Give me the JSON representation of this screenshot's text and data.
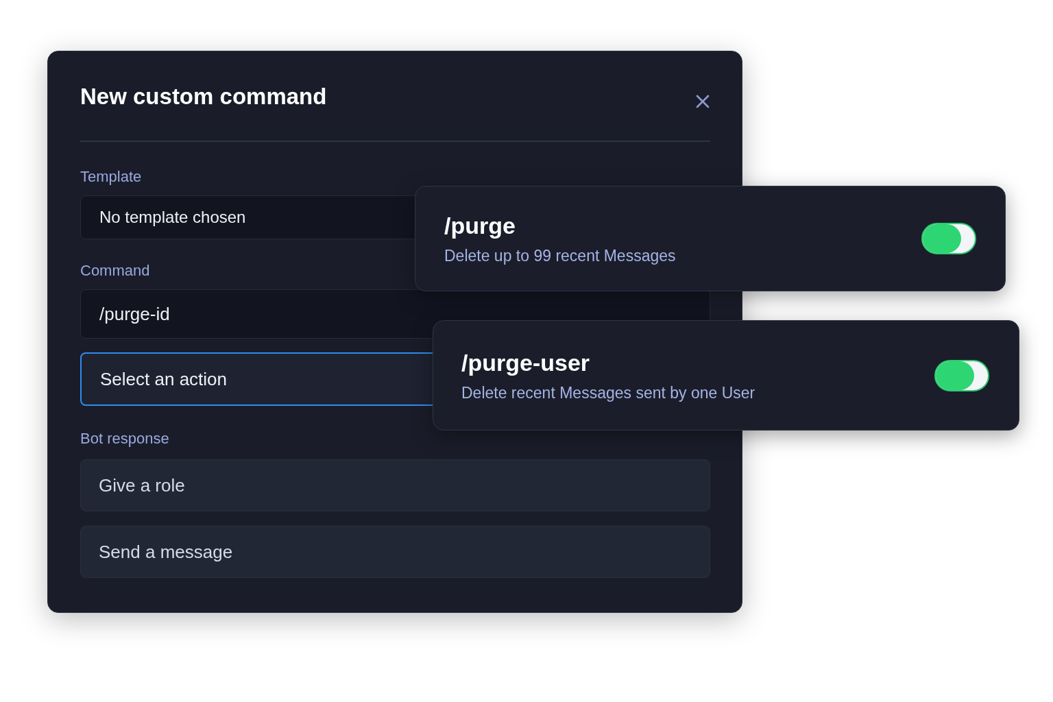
{
  "dialog": {
    "title": "New custom command",
    "template": {
      "label": "Template",
      "value": "No template chosen"
    },
    "command": {
      "label": "Command",
      "value": "/purge-id"
    },
    "action": {
      "value": "Select an action",
      "focused": true
    },
    "bot_response": {
      "label": "Bot response",
      "options": [
        "Give a role",
        "Send a message"
      ]
    }
  },
  "commands": [
    {
      "name": "/purge",
      "description": "Delete up to 99 recent Messages",
      "on": true
    },
    {
      "name": "/purge-user",
      "description": "Delete recent Messages sent by one User",
      "on": true
    }
  ]
}
